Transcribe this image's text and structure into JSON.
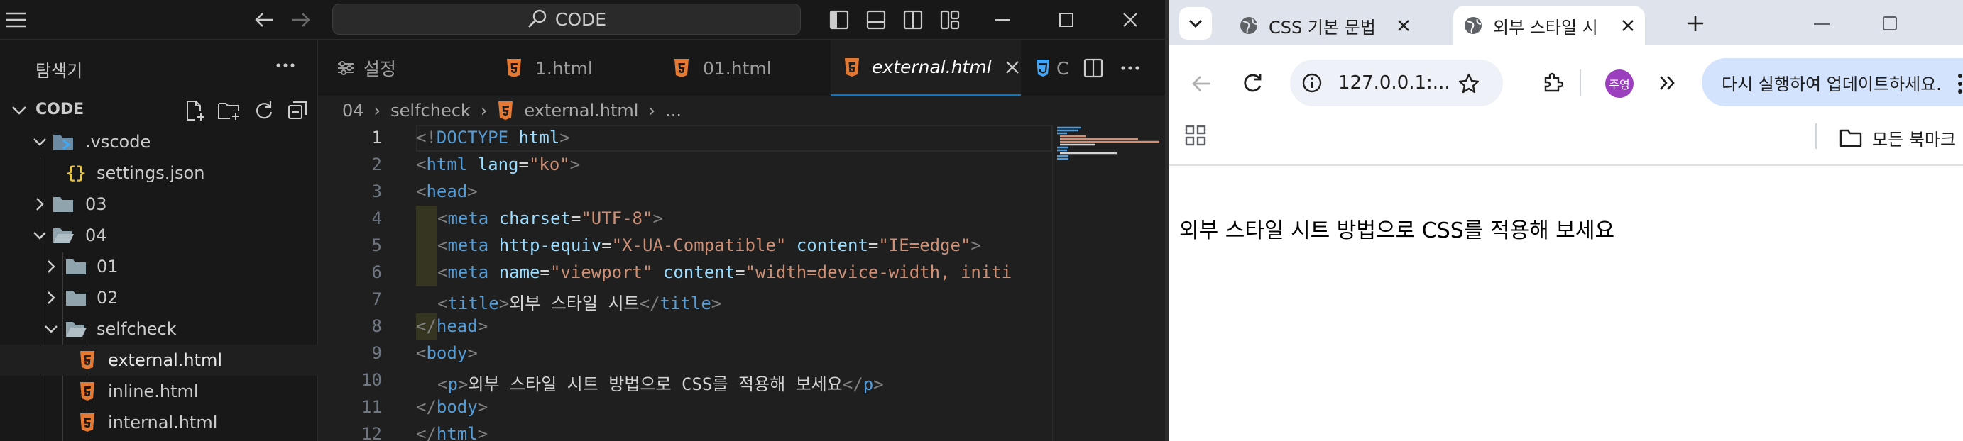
{
  "vscode": {
    "search_label": "CODE",
    "explorer_title": "탐색기",
    "root_label": "CODE",
    "tree": [
      {
        "label": ".vscode"
      },
      {
        "label": "settings.json"
      },
      {
        "label": "03"
      },
      {
        "label": "04"
      },
      {
        "label": "01"
      },
      {
        "label": "02"
      },
      {
        "label": "selfcheck"
      },
      {
        "label": "external.html"
      },
      {
        "label": "inline.html"
      },
      {
        "label": "internal.html"
      }
    ],
    "tabs": [
      {
        "label": "설정"
      },
      {
        "label": "1.html"
      },
      {
        "label": "01.html"
      },
      {
        "label": "external.html"
      },
      {
        "label": "C"
      }
    ],
    "breadcrumb": [
      "04",
      "selfcheck",
      "external.html",
      "..."
    ],
    "line_numbers": [
      "1",
      "2",
      "3",
      "4",
      "5",
      "6",
      "7",
      "8",
      "9",
      "10",
      "11",
      "12"
    ],
    "code": {
      "l1": {
        "open": "<!",
        "tag": "DOCTYPE",
        "attr": "html",
        "close": ">"
      },
      "l2": {
        "tag": "html",
        "attr": "lang",
        "val": "\"ko\""
      },
      "l3": {
        "tag": "head"
      },
      "l4": {
        "tag": "meta",
        "attr": "charset",
        "val": "\"UTF-8\""
      },
      "l5": {
        "tag": "meta",
        "attr1": "http-equiv",
        "val1": "\"X-UA-Compatible\"",
        "attr2": "content",
        "val2": "\"IE=edge\""
      },
      "l6": {
        "tag": "meta",
        "attr1": "name",
        "val1": "\"viewport\"",
        "attr2": "content",
        "val2": "\"width=device-width, initi"
      },
      "l7": {
        "tag": "title",
        "text": "외부 스타일 시트"
      },
      "l8": {
        "tag": "head"
      },
      "l9": {
        "tag": "body"
      },
      "l10": {
        "tag": "p",
        "text": "외부 스타일 시트 방법으로 CSS를 적용해 보세요"
      },
      "l11": {
        "tag": "body"
      },
      "l12": {
        "tag": "html"
      }
    }
  },
  "chrome": {
    "tabs": [
      {
        "label": "CSS 기본 문법"
      },
      {
        "label": "외부 스타일 시트"
      }
    ],
    "url": "127.0.0.1:...",
    "profile_initials": "주영",
    "update_label": "다시 실행하여 업데이트하세요.",
    "bookmarks_all": "모든 북마크",
    "page_text": "외부 스타일 시트 방법으로 CSS를 적용해 보세요"
  },
  "colors": {
    "html_icon": "#e37933",
    "folder_icon": "#90a4ae",
    "accent": "#0078d4"
  }
}
